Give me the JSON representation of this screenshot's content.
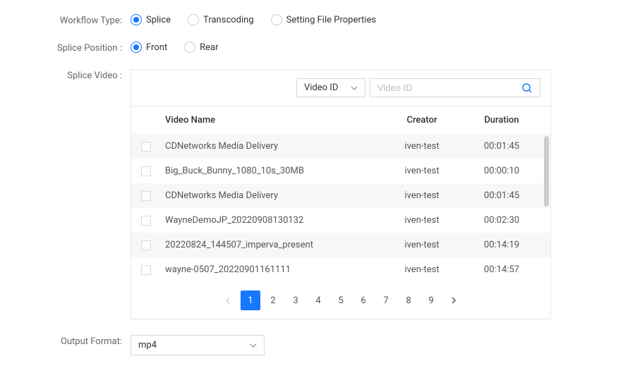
{
  "workflow": {
    "label": "Workflow Type:",
    "options": [
      {
        "label": "Splice",
        "checked": true
      },
      {
        "label": "Transcoding",
        "checked": false
      },
      {
        "label": "Setting File Properties",
        "checked": false
      }
    ]
  },
  "splicePosition": {
    "label": "Splice Position :",
    "options": [
      {
        "label": "Front",
        "checked": true
      },
      {
        "label": "Rear",
        "checked": false
      }
    ]
  },
  "spliceVideo": {
    "label": "Splice Video :",
    "searchType": "Video ID",
    "searchPlaceholder": "Video ID",
    "headers": {
      "name": "Video Name",
      "creator": "Creator",
      "duration": "Duration"
    },
    "rows": [
      {
        "name": "CDNetworks Media Delivery",
        "creator": "iven-test",
        "duration": "00:01:45"
      },
      {
        "name": "Big_Buck_Bunny_1080_10s_30MB",
        "creator": "iven-test",
        "duration": "00:00:10"
      },
      {
        "name": "CDNetworks Media Delivery",
        "creator": "iven-test",
        "duration": "00:01:45"
      },
      {
        "name": "WayneDemoJP_20220908130132",
        "creator": "iven-test",
        "duration": "00:02:30"
      },
      {
        "name": "20220824_144507_imperva_present",
        "creator": "iven-test",
        "duration": "00:14:19"
      },
      {
        "name": "wayne-0507_20220901161111",
        "creator": "iven-test",
        "duration": "00:14:57"
      }
    ],
    "pagination": {
      "pages": [
        "1",
        "2",
        "3",
        "4",
        "5",
        "6",
        "7",
        "8",
        "9"
      ],
      "current": "1"
    }
  },
  "outputFormat": {
    "label": "Output Format:",
    "value": "mp4"
  }
}
